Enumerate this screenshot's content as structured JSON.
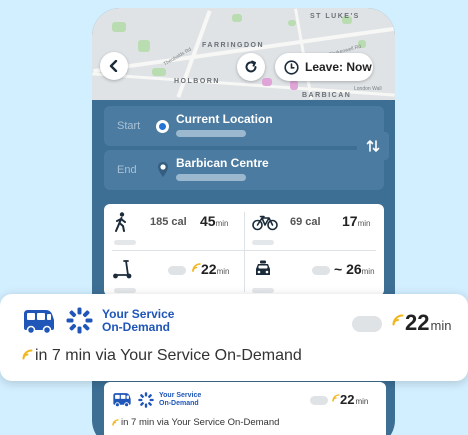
{
  "map": {
    "labels": [
      "ST LUKE'S",
      "FARRINGDON",
      "HOLBORN",
      "BARBICAN"
    ],
    "small_labels": [
      "Theobalds Rd",
      "Clerkenwell Rd",
      "London Wall"
    ]
  },
  "header": {
    "leave_label": "Leave: Now"
  },
  "route": {
    "start_label": "Start",
    "start_value": "Current Location",
    "end_label": "End",
    "end_value": "Barbican Centre"
  },
  "modes": {
    "walk": {
      "cal": "185 cal",
      "time": "45",
      "unit": "min"
    },
    "bike": {
      "cal": "69 cal",
      "time": "17",
      "unit": "min"
    },
    "scooter": {
      "time": "22",
      "unit": "min"
    },
    "taxi": {
      "time": "~ 26",
      "unit": "min"
    }
  },
  "on_demand": {
    "brand_line1": "Your Service",
    "brand_line2": "On-Demand",
    "time": "22",
    "unit": "min",
    "via": "in 7 min via Your Service On-Demand"
  },
  "colors": {
    "background": "#d2efff",
    "panel": "#3d6f95",
    "brand_blue": "#1f56b8",
    "realtime_yellow": "#f2b61f"
  }
}
